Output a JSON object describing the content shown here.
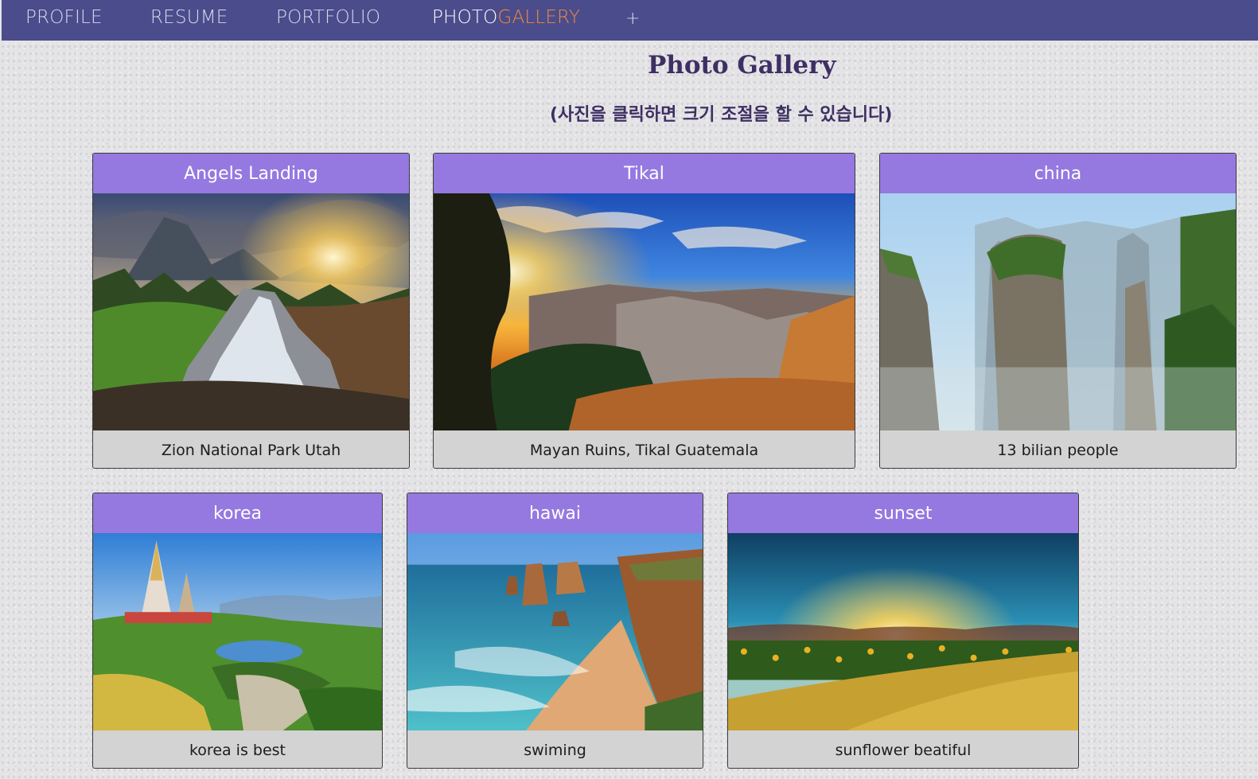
{
  "nav": {
    "items": [
      {
        "label": "PROFILE"
      },
      {
        "label": "RESUME"
      },
      {
        "label": "PORTFOLIO"
      }
    ],
    "active_main": "PHOTO",
    "active_accent": "GALLERY",
    "add_label": "+"
  },
  "header": {
    "title": "Photo Gallery",
    "subtitle": "(사진을 클릭하면 크기 조절을 할 수 있습니다)"
  },
  "gallery": {
    "cards": [
      {
        "title": "Angels Landing",
        "caption": "Zion National Park Utah",
        "image": "mountain-waterfall-sunset-photo"
      },
      {
        "title": "Tikal",
        "caption": "Mayan Ruins, Tikal Guatemala",
        "image": "canyon-sunburst-photo"
      },
      {
        "title": "china",
        "caption": "13 bilian people",
        "image": "karst-pillars-photo"
      },
      {
        "title": "korea",
        "caption": "korea is best",
        "image": "pagoda-garden-photo"
      },
      {
        "title": "hawai",
        "caption": "swiming",
        "image": "coastal-cliffs-photo"
      },
      {
        "title": "sunset",
        "caption": "sunflower beatiful",
        "image": "sunflower-field-sunset-photo"
      }
    ]
  },
  "colors": {
    "nav_bg": "#4b4c8b",
    "nav_accent": "#f08a3c",
    "card_header": "#9579e0",
    "card_footer": "#d3d3d3",
    "title_text": "#3e2f63"
  }
}
